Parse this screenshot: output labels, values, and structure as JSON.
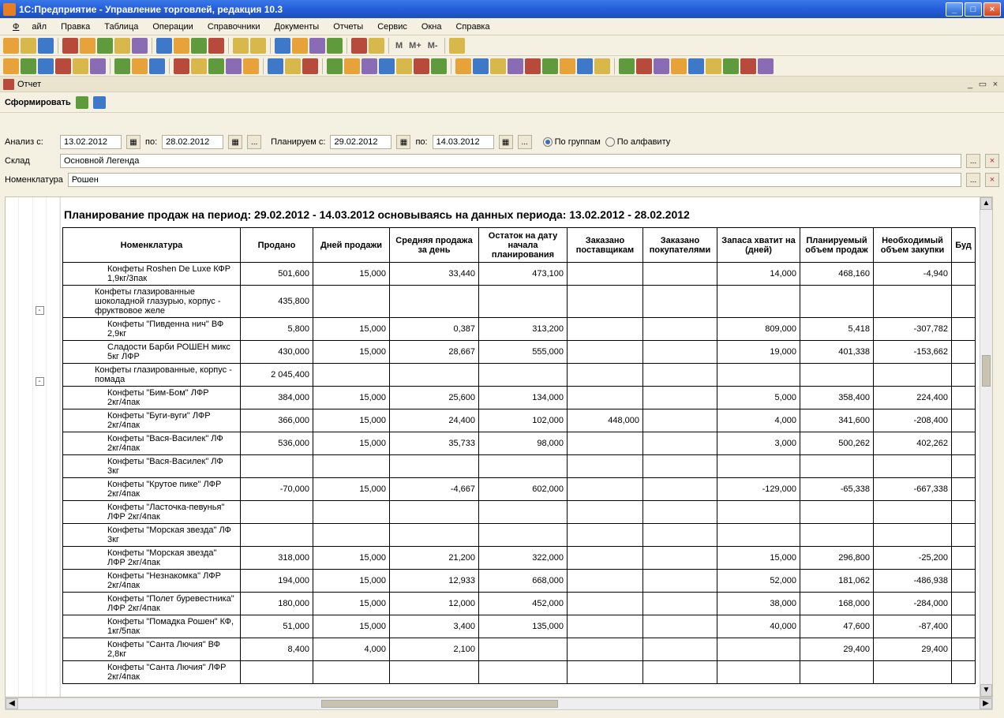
{
  "window": {
    "title": "1С:Предприятие - Управление торговлей, редакция 10.3"
  },
  "menu": {
    "file": "Файл",
    "edit": "Правка",
    "table": "Таблица",
    "operations": "Операции",
    "references": "Справочники",
    "documents": "Документы",
    "reports": "Отчеты",
    "service": "Сервис",
    "windows": "Окна",
    "help": "Справка"
  },
  "toolbar_text": {
    "m": "M",
    "mplus": "M+",
    "mminus": "M-"
  },
  "doctab": {
    "label": "Отчет"
  },
  "formbar": {
    "generate": "Сформировать"
  },
  "params": {
    "analyze_from_lbl": "Анализ с:",
    "analyze_from": "13.02.2012",
    "to_lbl": "по:",
    "analyze_to": "28.02.2012",
    "plan_from_lbl": "Планируем с:",
    "plan_from": "29.02.2012",
    "plan_to": "14.03.2012",
    "radio_groups": "По группам",
    "radio_alpha": "По алфавиту",
    "warehouse_lbl": "Склад",
    "warehouse_val": "Основной Легенда",
    "nomenclature_lbl": "Номенклатура",
    "nomenclature_val": "Рошен",
    "dots": "...",
    "x": "×"
  },
  "report": {
    "title": "Планирование продаж на период: 29.02.2012 - 14.03.2012  основываясь на данных периода: 13.02.2012 - 28.02.2012",
    "columns": [
      "Номенклатура",
      "Продано",
      "Дней продажи",
      "Средняя продажа за день",
      "Остаток на дату начала планирования",
      "Заказано поставщикам",
      "Заказано покупателями",
      "Запаса хватит на (дней)",
      "Планируемый объем продаж",
      "Необходимый объем закупки",
      "Буд"
    ],
    "rows": [
      {
        "indent": 3,
        "name": "Конфеты Roshen De Luxe КФР 1,9кг/3пак",
        "sold": "501,600",
        "days": "15,000",
        "avg": "33,440",
        "stock": "473,100",
        "ord_sup": "",
        "ord_buy": "",
        "enough": "14,000",
        "plan": "468,160",
        "need": "-4,940"
      },
      {
        "indent": 2,
        "name": "Конфеты глазированные шоколадной глазурью, корпус - фруктвовое желе",
        "sold": "435,800",
        "days": "",
        "avg": "",
        "stock": "",
        "ord_sup": "",
        "ord_buy": "",
        "enough": "",
        "plan": "",
        "need": ""
      },
      {
        "indent": 3,
        "name": "Конфеты \"Пивденна нич\" ВФ 2,9кг",
        "sold": "5,800",
        "days": "15,000",
        "avg": "0,387",
        "stock": "313,200",
        "ord_sup": "",
        "ord_buy": "",
        "enough": "809,000",
        "plan": "5,418",
        "need": "-307,782"
      },
      {
        "indent": 3,
        "name": "Сладости Барби РОШЕН микс 5кг ЛФР",
        "sold": "430,000",
        "days": "15,000",
        "avg": "28,667",
        "stock": "555,000",
        "ord_sup": "",
        "ord_buy": "",
        "enough": "19,000",
        "plan": "401,338",
        "need": "-153,662"
      },
      {
        "indent": 2,
        "name": "Конфеты глазированные, корпус - помада",
        "sold": "2 045,400",
        "days": "",
        "avg": "",
        "stock": "",
        "ord_sup": "",
        "ord_buy": "",
        "enough": "",
        "plan": "",
        "need": ""
      },
      {
        "indent": 3,
        "name": "Конфеты \"Бим-Бом\" ЛФР 2кг/4пак",
        "sold": "384,000",
        "days": "15,000",
        "avg": "25,600",
        "stock": "134,000",
        "ord_sup": "",
        "ord_buy": "",
        "enough": "5,000",
        "plan": "358,400",
        "need": "224,400"
      },
      {
        "indent": 3,
        "name": "Конфеты \"Буги-вуги\" ЛФР 2кг/4пак",
        "sold": "366,000",
        "days": "15,000",
        "avg": "24,400",
        "stock": "102,000",
        "ord_sup": "448,000",
        "ord_buy": "",
        "enough": "4,000",
        "plan": "341,600",
        "need": "-208,400"
      },
      {
        "indent": 3,
        "name": "Конфеты \"Вася-Василек\" ЛФ 2кг/4пак",
        "sold": "536,000",
        "days": "15,000",
        "avg": "35,733",
        "stock": "98,000",
        "ord_sup": "",
        "ord_buy": "",
        "enough": "3,000",
        "plan": "500,262",
        "need": "402,262"
      },
      {
        "indent": 3,
        "name": "Конфеты \"Вася-Василек\" ЛФ 3кг",
        "sold": "",
        "days": "",
        "avg": "",
        "stock": "",
        "ord_sup": "",
        "ord_buy": "",
        "enough": "",
        "plan": "",
        "need": ""
      },
      {
        "indent": 3,
        "name": "Конфеты \"Крутое пике\" ЛФР 2кг/4пак",
        "sold": "-70,000",
        "days": "15,000",
        "avg": "-4,667",
        "stock": "602,000",
        "ord_sup": "",
        "ord_buy": "",
        "enough": "-129,000",
        "plan": "-65,338",
        "need": "-667,338"
      },
      {
        "indent": 3,
        "name": "Конфеты \"Ласточка-певунья\" ЛФР 2кг/4пак",
        "sold": "",
        "days": "",
        "avg": "",
        "stock": "",
        "ord_sup": "",
        "ord_buy": "",
        "enough": "",
        "plan": "",
        "need": ""
      },
      {
        "indent": 3,
        "name": "Конфеты \"Морская звезда\" ЛФ 3кг",
        "sold": "",
        "days": "",
        "avg": "",
        "stock": "",
        "ord_sup": "",
        "ord_buy": "",
        "enough": "",
        "plan": "",
        "need": ""
      },
      {
        "indent": 3,
        "name": "Конфеты \"Морская звезда\" ЛФР 2кг/4пак",
        "sold": "318,000",
        "days": "15,000",
        "avg": "21,200",
        "stock": "322,000",
        "ord_sup": "",
        "ord_buy": "",
        "enough": "15,000",
        "plan": "296,800",
        "need": "-25,200"
      },
      {
        "indent": 3,
        "name": "Конфеты \"Незнакомка\" ЛФР 2кг/4пак",
        "sold": "194,000",
        "days": "15,000",
        "avg": "12,933",
        "stock": "668,000",
        "ord_sup": "",
        "ord_buy": "",
        "enough": "52,000",
        "plan": "181,062",
        "need": "-486,938"
      },
      {
        "indent": 3,
        "name": "Конфеты \"Полет буревестника\" ЛФР 2кг/4пак",
        "sold": "180,000",
        "days": "15,000",
        "avg": "12,000",
        "stock": "452,000",
        "ord_sup": "",
        "ord_buy": "",
        "enough": "38,000",
        "plan": "168,000",
        "need": "-284,000"
      },
      {
        "indent": 3,
        "name": "Конфеты \"Помадка Рошен\" КФ, 1кг/5пак",
        "sold": "51,000",
        "days": "15,000",
        "avg": "3,400",
        "stock": "135,000",
        "ord_sup": "",
        "ord_buy": "",
        "enough": "40,000",
        "plan": "47,600",
        "need": "-87,400"
      },
      {
        "indent": 3,
        "name": "Конфеты \"Санта Лючия\" ВФ 2,8кг",
        "sold": "8,400",
        "days": "4,000",
        "avg": "2,100",
        "stock": "",
        "ord_sup": "",
        "ord_buy": "",
        "enough": "",
        "plan": "29,400",
        "need": "29,400"
      },
      {
        "indent": 3,
        "name": "Конфеты \"Санта Лючия\" ЛФР 2кг/4пак",
        "sold": "",
        "days": "",
        "avg": "",
        "stock": "",
        "ord_sup": "",
        "ord_buy": "",
        "enough": "",
        "plan": "",
        "need": ""
      }
    ]
  }
}
